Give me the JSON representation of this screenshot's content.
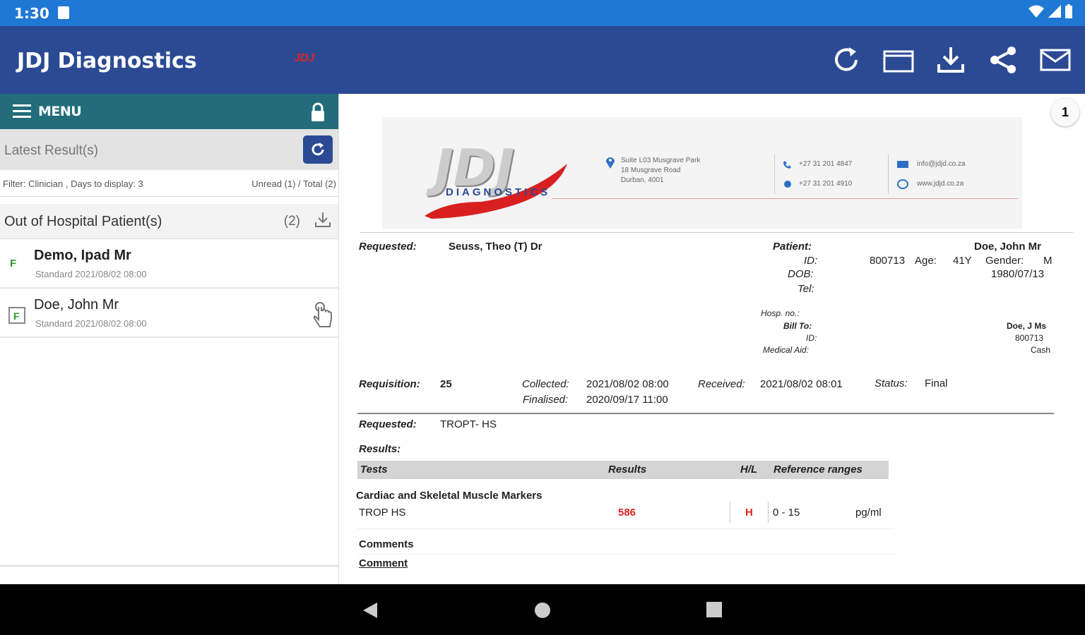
{
  "status": {
    "time": "1:30"
  },
  "app": {
    "title": "JDJ Diagnostics",
    "logo_small": "JDJ"
  },
  "sidebar": {
    "menu_label": "MENU",
    "latest_label": "Latest Result(s)",
    "filter_left": "Filter: Clinician , Days to display: 3",
    "filter_right": "Unread (1)  / Total (2)",
    "group_label": "Out of Hospital Patient(s)",
    "group_count": "(2)",
    "patients": [
      {
        "name": "Demo, Ipad Mr",
        "sub": "Standard 2021/08/02 08:00",
        "flag": "F"
      },
      {
        "name": "Doe, John Mr",
        "sub": "Standard 2021/08/02 08:00",
        "flag": "F"
      }
    ]
  },
  "report": {
    "page": "1",
    "lab": {
      "logo_text": "JDJ",
      "logo_sub": "DIAGNOSTICS",
      "addr1": "Suite L03 Musgrave Park",
      "addr2": "18 Musgrave Road",
      "addr3": "Durban, 4001",
      "phone1": "+27 31 201 4847",
      "phone2": "+27 31 201 4910",
      "email": "info@jdjd.co.za",
      "web": "www.jdjd.co.za"
    },
    "requested_label": "Requested:",
    "requested_value": "Seuss, Theo (T) Dr",
    "patient_label": "Patient:",
    "patient_name": "Doe, John Mr",
    "id_label": "ID:",
    "id_value": "800713",
    "age_label": "Age:",
    "age_value": "41Y",
    "gender_label": "Gender:",
    "gender_value": "M",
    "dob_label": "DOB:",
    "dob_value": "1980/07/13",
    "tel_label": "Tel:",
    "hosp_label": "Hosp. no.:",
    "billto_label": "Bill To:",
    "billto_value": "Doe, J Ms",
    "bill_id_label": "ID:",
    "bill_id_value": "800713",
    "medaid_label": "Medical Aid:",
    "medaid_value": "Cash",
    "requisition_label": "Requisition:",
    "requisition_value": "25",
    "collected_label": "Collected:",
    "collected_value": "2021/08/02 08:00",
    "finalised_label": "Finalised:",
    "finalised_value": "2020/09/17 11:00",
    "received_label": "Received:",
    "received_value": "2021/08/02 08:01",
    "status_label": "Status:",
    "status_value": "Final",
    "req_tests_label": "Requested:",
    "req_tests_value": "TROPT- HS",
    "results_label": "Results:",
    "col_tests": "Tests",
    "col_results": "Results",
    "col_hl": "H/L",
    "col_ref": "Reference ranges",
    "section": "Cardiac and Skeletal Muscle Markers",
    "test_name": "TROP HS",
    "test_result": "586",
    "test_flag": "H",
    "test_range": "0 - 15",
    "test_unit": "pg/ml",
    "comments_label": "Comments",
    "comment_label": "Comment"
  },
  "colors": {
    "appbar": "#2b4a93",
    "statusbar": "#1e78d4",
    "menu": "#236c7a",
    "flag_high": "#e02424"
  }
}
